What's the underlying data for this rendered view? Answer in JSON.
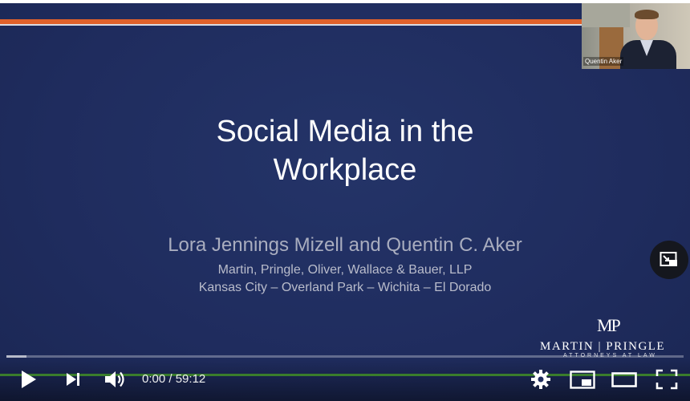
{
  "slide": {
    "title_line1": "Social Media in the",
    "title_line2": "Workplace",
    "presenters": "Lora Jennings Mizell and Quentin C. Aker",
    "firm": "Martin, Pringle, Oliver, Wallace & Bauer, LLP",
    "locations": "Kansas City – Overland Park – Wichita – El Dorado",
    "logo_mark": "MP",
    "logo_name": "MARTIN | PRINGLE",
    "logo_sub": "ATTORNEYS AT LAW"
  },
  "webcam": {
    "name": "Quentin Aker"
  },
  "player": {
    "current_time": "0:00",
    "separator": " / ",
    "duration": "59:12",
    "progress_played": 0.0,
    "progress_buffered": 0.03
  },
  "icons": {
    "play": "play-icon",
    "next": "next-icon",
    "volume": "volume-icon",
    "settings": "gear-icon",
    "miniplayer": "miniplayer-icon",
    "theater": "theater-mode-icon",
    "fullscreen": "fullscreen-icon",
    "pip": "picture-in-picture-icon"
  },
  "colors": {
    "slide_bg": "#1f2c5e",
    "accent_orange": "#e0612b",
    "progress_red": "#ff0000"
  }
}
